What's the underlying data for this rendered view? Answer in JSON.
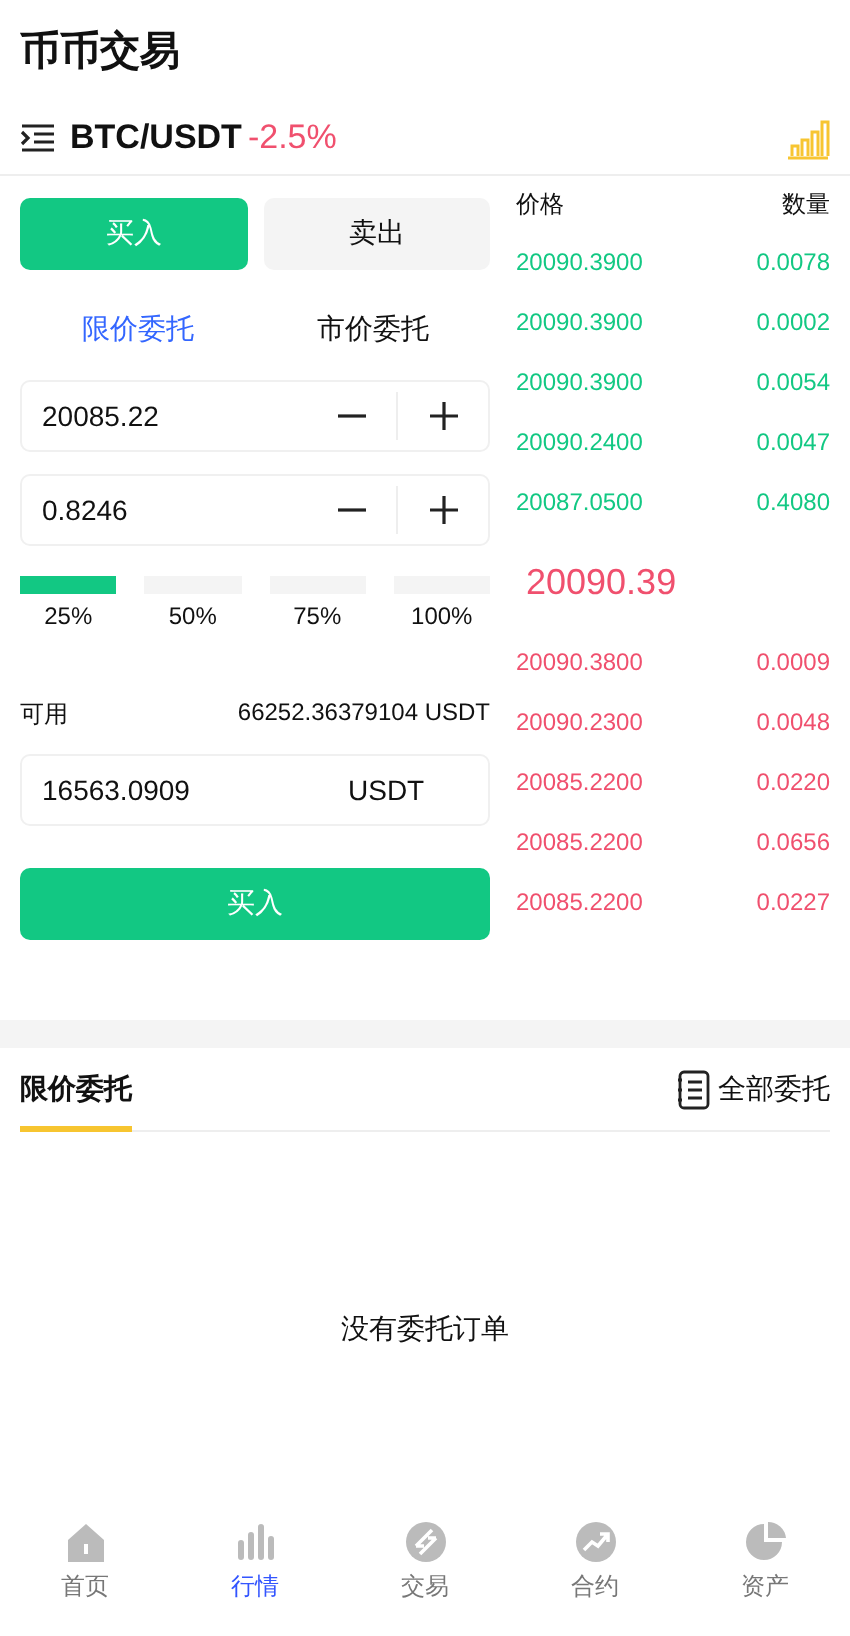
{
  "title": "币币交易",
  "pair": {
    "symbol": "BTC/USDT",
    "change": "-2.5%"
  },
  "side_tabs": [
    {
      "label": "买入",
      "selected": true
    },
    {
      "label": "卖出",
      "selected": false
    }
  ],
  "order_types": [
    {
      "label": "限价委托",
      "selected": true
    },
    {
      "label": "市价委托",
      "selected": false
    }
  ],
  "price_field": {
    "value": "20085.22"
  },
  "amount_field": {
    "value": "0.8246"
  },
  "percentages": [
    {
      "label": "25%",
      "selected": true
    },
    {
      "label": "50%",
      "selected": false
    },
    {
      "label": "75%",
      "selected": false
    },
    {
      "label": "100%",
      "selected": false
    }
  ],
  "available": {
    "label": "可用",
    "value": "66252.36379104 USDT"
  },
  "total_field": {
    "value": "16563.0909",
    "unit": "USDT"
  },
  "submit_button": "买入",
  "order_book": {
    "columns": [
      "价格",
      "数量"
    ],
    "rows": [
      {
        "kind": "bid",
        "price": "20090.3900",
        "amount": "0.0078"
      },
      {
        "kind": "bid",
        "price": "20090.3900",
        "amount": "0.0002"
      },
      {
        "kind": "bid",
        "price": "20090.3900",
        "amount": "0.0054"
      },
      {
        "kind": "bid",
        "price": "20090.2400",
        "amount": "0.0047"
      },
      {
        "kind": "bid",
        "price": "20087.0500",
        "amount": "0.4080"
      },
      {
        "kind": "last",
        "price": "20090.39"
      },
      {
        "kind": "ask",
        "price": "20090.3800",
        "amount": "0.0009"
      },
      {
        "kind": "ask",
        "price": "20090.2300",
        "amount": "0.0048"
      },
      {
        "kind": "ask",
        "price": "20085.2200",
        "amount": "0.0220"
      },
      {
        "kind": "ask",
        "price": "20085.2200",
        "amount": "0.0656"
      },
      {
        "kind": "ask",
        "price": "20085.2200",
        "amount": "0.0227"
      }
    ]
  },
  "orders": {
    "tab": "限价委托",
    "all_link": "全部委托",
    "empty": "没有委托订单"
  },
  "nav": [
    {
      "label": "首页",
      "selected": false
    },
    {
      "label": "行情",
      "selected": true
    },
    {
      "label": "交易",
      "selected": false
    },
    {
      "label": "合约",
      "selected": false
    },
    {
      "label": "资产",
      "selected": false
    }
  ]
}
